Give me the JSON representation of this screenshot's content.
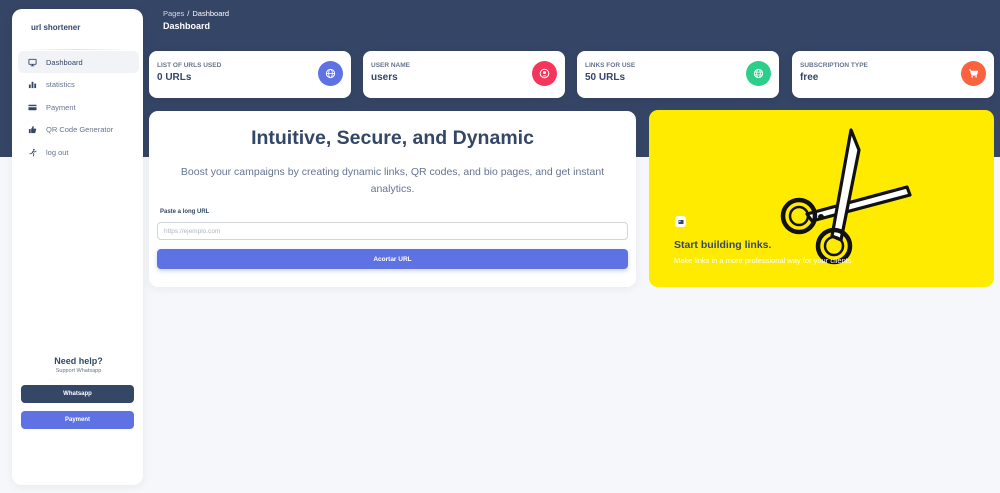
{
  "sidebar": {
    "brand": "url shortener",
    "items": [
      {
        "label": "Dashboard",
        "icon": "monitor-icon",
        "active": true
      },
      {
        "label": "statistics",
        "icon": "bar-chart-icon",
        "active": false
      },
      {
        "label": "Payment",
        "icon": "credit-card-icon",
        "active": false
      },
      {
        "label": "QR Code Generator",
        "icon": "thumb-icon",
        "active": false
      },
      {
        "label": "log out",
        "icon": "logout-icon",
        "active": false
      }
    ],
    "help_title": "Need help?",
    "help_sub": "Support Whatsapp",
    "whatsapp_button": "Whatsapp",
    "payment_button": "Payment"
  },
  "header": {
    "breadcrumb_root": "Pages",
    "breadcrumb_separator": "/",
    "breadcrumb_current": "Dashboard",
    "title": "Dashboard"
  },
  "stats": [
    {
      "label": "LIST OF URLS USED",
      "value": "0 URLs",
      "icon": "globe-icon",
      "color": "#5e72e4"
    },
    {
      "label": "USER NAME",
      "value": "users",
      "icon": "user-icon",
      "color": "#f5365c"
    },
    {
      "label": "LINKS FOR USE",
      "value": "50 URLs",
      "icon": "world-icon",
      "color": "#2dce89"
    },
    {
      "label": "SUBSCRIPTION TYPE",
      "value": "free",
      "icon": "cart-icon",
      "color": "#fb6340"
    }
  ],
  "main": {
    "title": "Intuitive, Secure, and Dynamic",
    "subtitle": "Boost your campaigns by creating dynamic links, QR codes, and bio pages, and get instant analytics.",
    "url_label": "Paste a long URL",
    "url_placeholder": "https://ejemplo.com",
    "url_value": "",
    "shorten_button": "Acortar URL"
  },
  "promo": {
    "title": "Start building links.",
    "subtitle": "Make links in a more professional way for your clients",
    "background": "#ffeb00",
    "icon": "scissors-icon"
  },
  "colors": {
    "header_bg": "#354566",
    "primary": "#5e72e4",
    "dark": "#344767"
  }
}
